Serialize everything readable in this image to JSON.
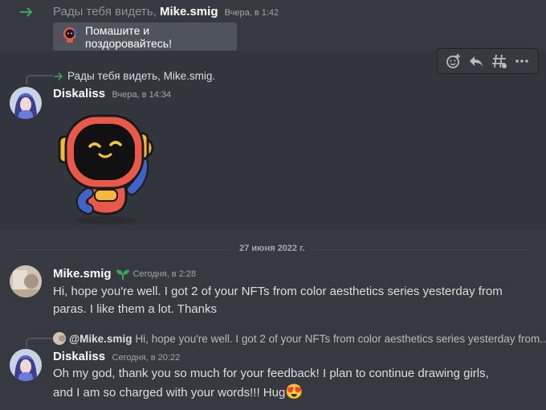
{
  "system_join": {
    "greeting": "Рады тебя видеть,",
    "username": "Mike.smig",
    "timestamp": "Вчера, в 1:42",
    "wave_button_label": "Помашите и поздоровайтесь!"
  },
  "toolbar": {
    "icons": [
      "add-reaction-icon",
      "reply-icon",
      "create-thread-icon",
      "more-icon"
    ]
  },
  "message1": {
    "reply_preview": "Рады тебя видеть, Mike.smig.",
    "author": "Diskaliss",
    "timestamp": "Вчера, в 14:34",
    "sticker": "wumpus-robot-wave-sticker"
  },
  "date_divider": "27 июня 2022 г.",
  "message2": {
    "author": "Mike.smig",
    "timestamp": "Сегодня, в 2:28",
    "badge": "sprout-icon",
    "text": "Hi, hope you're well. I got 2 of your NFTs from color aesthetics series yesterday from paras. I like them a lot. Thanks"
  },
  "message3": {
    "reply_to": "@Mike.smig",
    "reply_preview": "Hi, hope you're well. I got 2 of your NFTs from color aesthetics series yesterday from...",
    "author": "Diskaliss",
    "timestamp": "Сегодня, в 20:22",
    "text": "Oh my god, thank you so much for your feedback! I plan to continue drawing girls, and I am so charged with your words!!! Hug",
    "emoji": "😍"
  },
  "colors": {
    "background": "#36393f",
    "hover_background": "#32353b",
    "join_arrow": "#3ba55c",
    "robot_body": "#e9594a",
    "robot_arm": "#3e63c9"
  }
}
